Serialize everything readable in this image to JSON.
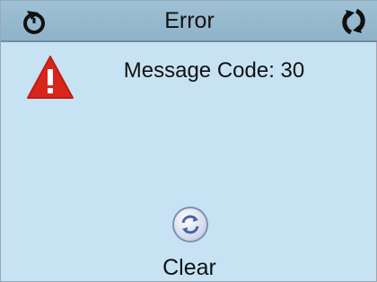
{
  "header": {
    "title": "Error",
    "back_icon": "back-arrow-icon",
    "refresh_icon": "refresh-icon"
  },
  "alert": {
    "icon": "warning-triangle-icon",
    "message": "Message Code: 30"
  },
  "actions": {
    "clear_label": "Clear",
    "clear_icon": "circular-arrows-icon"
  },
  "colors": {
    "background": "#c7e3f3",
    "header": "#97bace",
    "warning_red": "#d9251c"
  }
}
